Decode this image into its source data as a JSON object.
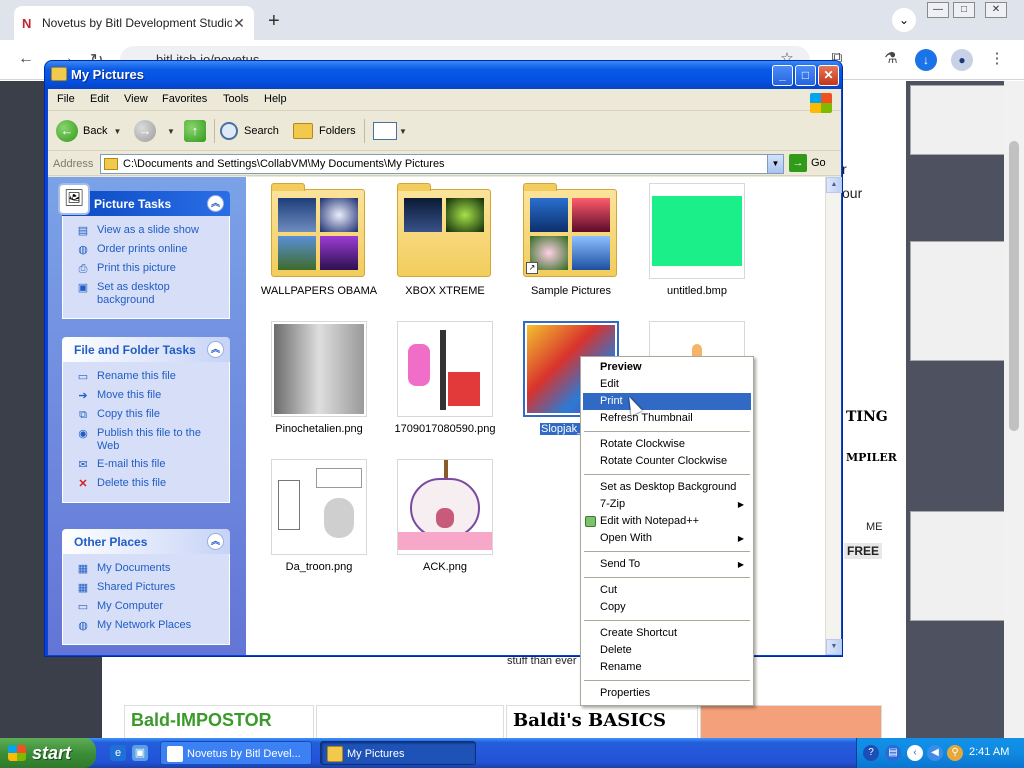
{
  "browser": {
    "tab_title": "Novetus by Bitl Development Studio",
    "tab_favicon": "N",
    "url": "bitl.itch.io/novetus",
    "page_fragments": {
      "line1": "r",
      "line2": "our",
      "ting": "TING",
      "mpiler": "MPILER",
      "me": "ME",
      "free": "FREE",
      "stuff": "stuff than ever",
      "promo1": "Bald-IMPOSTOR",
      "promo2": "Baldi's BASICS"
    }
  },
  "window": {
    "title": "My Pictures",
    "menu": [
      "File",
      "Edit",
      "View",
      "Favorites",
      "Tools",
      "Help"
    ],
    "toolbar": {
      "back": "Back",
      "search": "Search",
      "folders": "Folders"
    },
    "address": {
      "label": "Address",
      "path": "C:\\Documents and Settings\\CollabVM\\My Documents\\My Pictures",
      "go": "Go"
    }
  },
  "taskpane": {
    "picture_tasks": {
      "title": "Picture Tasks",
      "items": [
        "View as a slide show",
        "Order prints online",
        "Print this picture",
        "Set as desktop background"
      ]
    },
    "file_tasks": {
      "title": "File and Folder Tasks",
      "items": [
        "Rename this file",
        "Move this file",
        "Copy this file",
        "Publish this file to the Web",
        "E-mail this file",
        "Delete this file"
      ]
    },
    "other_places": {
      "title": "Other Places",
      "items": [
        "My Documents",
        "Shared Pictures",
        "My Computer",
        "My Network Places"
      ]
    }
  },
  "files": [
    {
      "name": "WALLPAPERS OBAMA",
      "kind": "folder"
    },
    {
      "name": "XBOX XTREME",
      "kind": "folder"
    },
    {
      "name": "Sample Pictures",
      "kind": "folder"
    },
    {
      "name": "untitled.bmp",
      "kind": "image"
    },
    {
      "name": "Pinochetalien.png",
      "kind": "image"
    },
    {
      "name": "1709017080590.png",
      "kind": "image"
    },
    {
      "name": "Slopjak_con",
      "kind": "image",
      "selected": true
    },
    {
      "name": "Da_troon.png",
      "kind": "image"
    },
    {
      "name": "ACK.png",
      "kind": "image"
    }
  ],
  "context_menu": {
    "items": [
      "Preview",
      "Edit",
      "Print",
      "Refresh Thumbnail",
      "Rotate Clockwise",
      "Rotate Counter Clockwise",
      "Set as Desktop Background",
      "7-Zip",
      "Edit with Notepad++",
      "Open With",
      "Send To",
      "Cut",
      "Copy",
      "Create Shortcut",
      "Delete",
      "Rename",
      "Properties"
    ],
    "highlighted": "Print"
  },
  "taskbar": {
    "start": "start",
    "buttons": [
      "Novetus by Bitl Devel...",
      "My Pictures"
    ],
    "clock": "2:41 AM"
  },
  "colors": {
    "xp_title_blue": "#0351e2",
    "selection": "#316ac5",
    "taskbar_blue": "#245edb",
    "start_green": "#3c8e38"
  }
}
